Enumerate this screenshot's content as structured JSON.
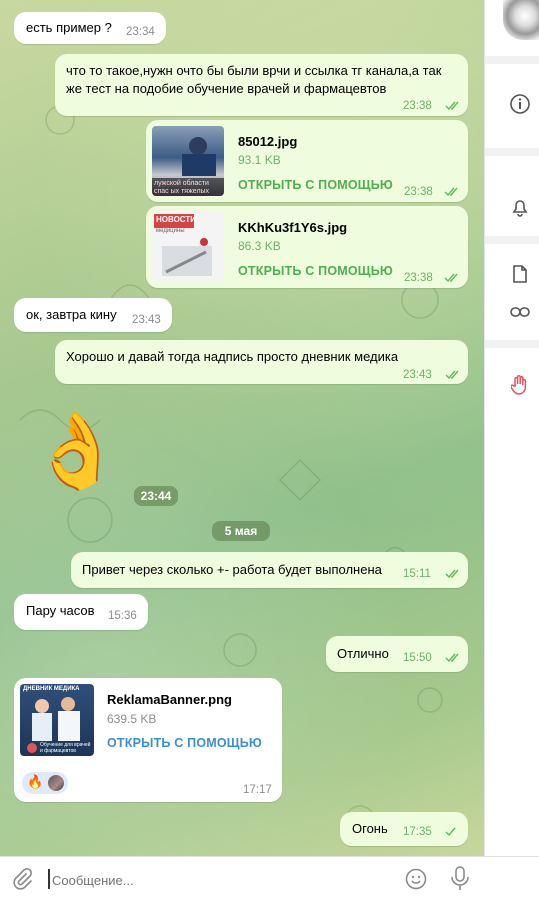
{
  "messages": {
    "m1": {
      "text": "есть пример ?",
      "time": "23:34"
    },
    "m2": {
      "line1": "что то такое,нужн очто бы были врчи и ссылка тг канала,а так",
      "line2": "же тест на подобие обучение врачей и фармацевтов",
      "time": "23:38"
    },
    "f1": {
      "name": "85012.jpg",
      "size": "93.1 KB",
      "open": "ОТКРЫТЬ С ПОМОЩЬЮ",
      "time": "23:38",
      "thumb_caption": "лужской области спас ых тяжелых пациенто"
    },
    "f2": {
      "name": "KKhKu3f1Y6s.jpg",
      "size": "86.3 KB",
      "open": "ОТКРЫТЬ С ПОМОЩЬЮ",
      "time": "23:38",
      "thumb_caption": "НОВОСТИ",
      "thumb_sub": "медицины"
    },
    "m3": {
      "text": "ок, завтра кину",
      "time": "23:43"
    },
    "m4": {
      "text": "Хорошо и давай тогда надпись просто дневник медика",
      "time": "23:43"
    },
    "sticker": {
      "emoji": "👌",
      "time": "23:44"
    },
    "date_divider": "5 мая",
    "m5": {
      "text": "Привет через сколько +- работа будет выполнена",
      "time": "15:11"
    },
    "m6": {
      "text": "Пару часов",
      "time": "15:36"
    },
    "m7": {
      "text": "Отлично",
      "time": "15:50"
    },
    "f3": {
      "name": "ReklamaBanner.png",
      "size": "639.5 KB",
      "open": "ОТКРЫТЬ С ПОМОЩЬЮ",
      "time": "17:17",
      "thumb_title": "ДНЕВНИК МЕДИКА",
      "thumb_sub": "Обучение для врачей и фармацевтов",
      "reaction": "🔥"
    },
    "m8": {
      "text": "Огонь",
      "time": "17:35"
    }
  },
  "input": {
    "placeholder": "Сообщение..."
  },
  "colors": {
    "outgoing": "#effdde",
    "incoming": "#ffffff",
    "accent_green": "#4fae4e",
    "accent_blue": "#3a8fd1",
    "alert_red": "#e05656"
  },
  "sidebar": {
    "icons": [
      "avatar",
      "info-icon",
      "bell-icon",
      "file-icon",
      "link-icon",
      "hand-icon"
    ]
  }
}
